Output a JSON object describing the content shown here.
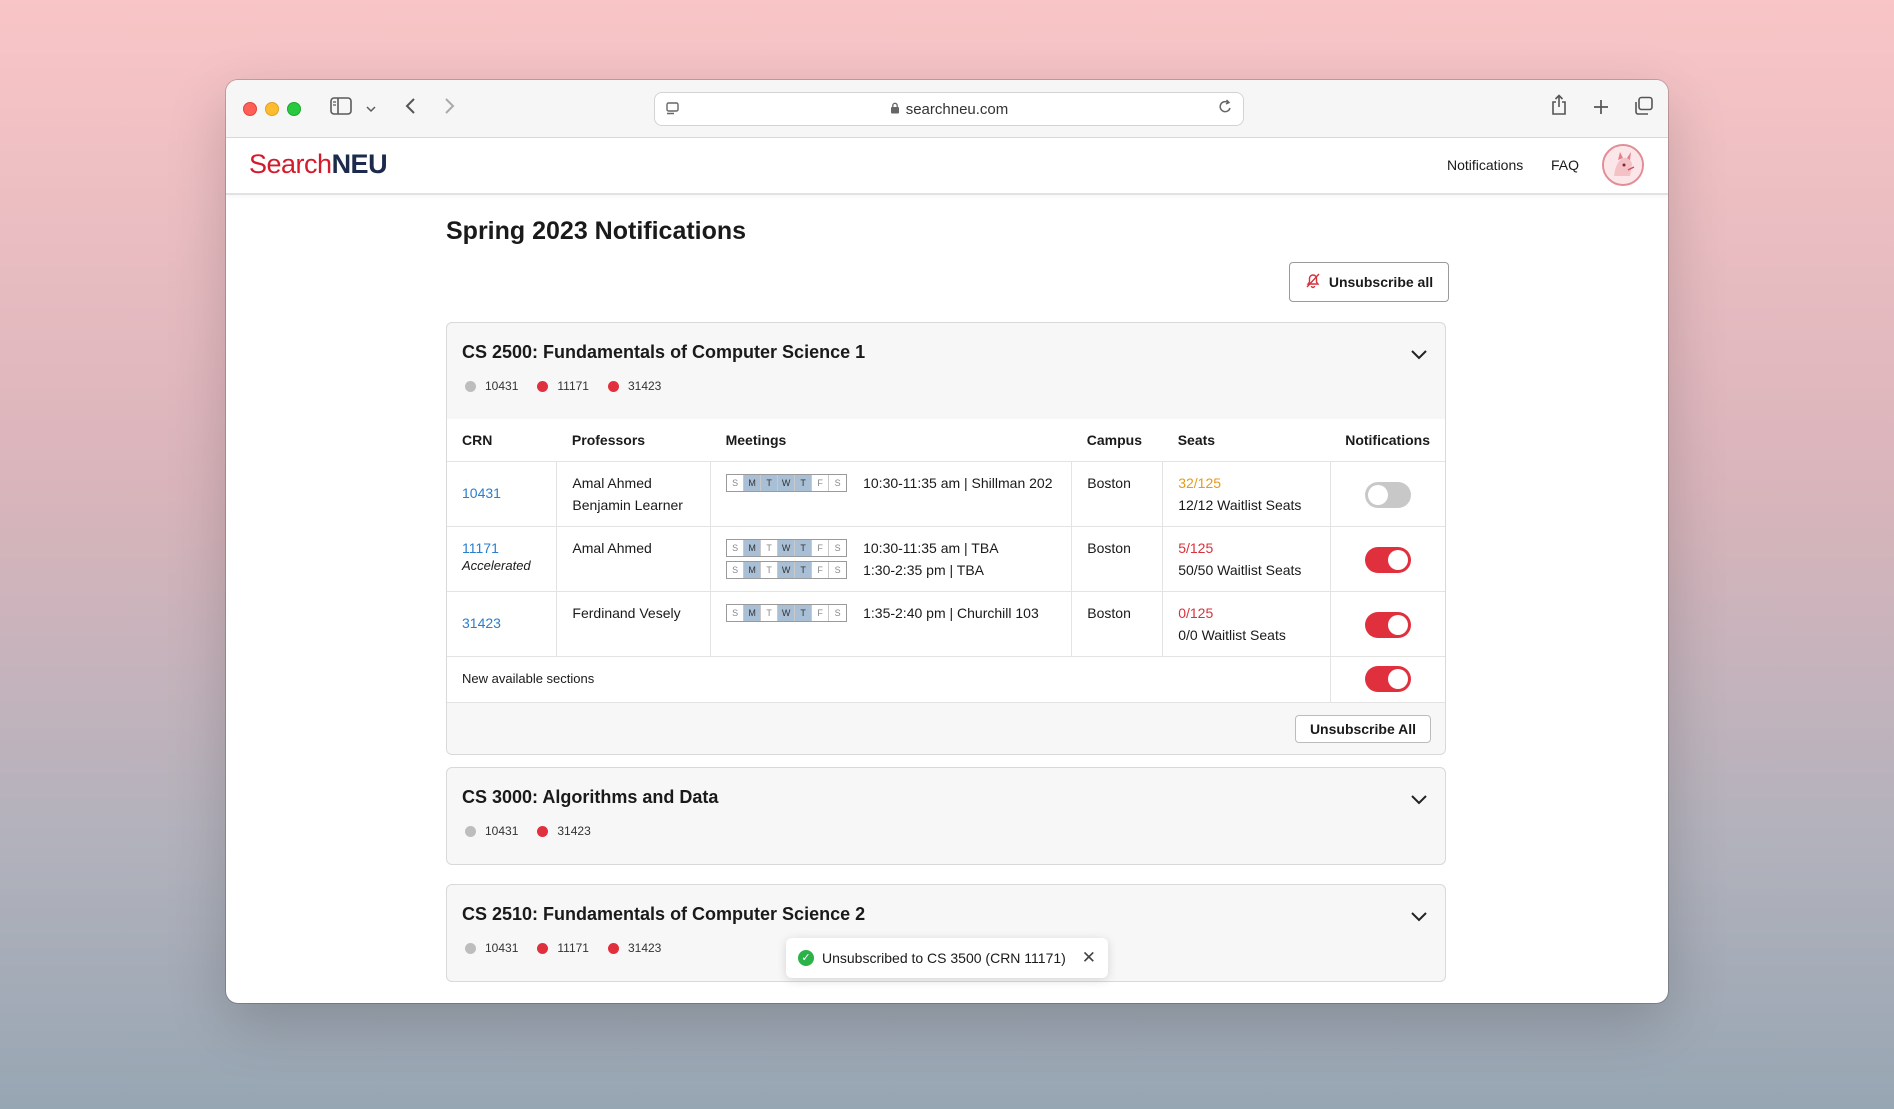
{
  "browser": {
    "url": "searchneu.com",
    "icons": [
      "sidebar-icon",
      "chevron-down-icon",
      "back-icon",
      "forward-icon",
      "reader-icon",
      "lock-icon",
      "reload-icon",
      "share-icon",
      "new-tab-icon",
      "tabs-overview-icon"
    ]
  },
  "site": {
    "logo_part1": "Search",
    "logo_part2": "NEU",
    "nav_notifications": "Notifications",
    "nav_faq": "FAQ"
  },
  "page": {
    "title": "Spring 2023 Notifications",
    "unsubscribe_all": "Unsubscribe all"
  },
  "courses": [
    {
      "title": "CS 2500: Fundamentals of Computer Science 1",
      "expanded": true,
      "pills": [
        {
          "crn": "10431",
          "status": "gray"
        },
        {
          "crn": "11171",
          "status": "red"
        },
        {
          "crn": "31423",
          "status": "red"
        }
      ],
      "columns": [
        "CRN",
        "Professors",
        "Meetings",
        "Campus",
        "Seats",
        "Notifications"
      ],
      "sections": [
        {
          "crn": "10431",
          "tag": "",
          "professors": [
            "Amal Ahmed",
            "Benjamin Learner"
          ],
          "meetings": [
            {
              "days": "SMTWTFS",
              "active": [
                1,
                2,
                3,
                4
              ],
              "text": "10:30-11:35 am | Shillman 202"
            }
          ],
          "campus": "Boston",
          "seats": "32/125",
          "seats_color": "orange",
          "waitlist": "12/12 Waitlist Seats",
          "notify": false
        },
        {
          "crn": "11171",
          "tag": "Accelerated",
          "professors": [
            "Amal Ahmed"
          ],
          "meetings": [
            {
              "days": "SMTWTFS",
              "active": [
                1,
                3,
                4
              ],
              "text": "10:30-11:35 am | TBA"
            },
            {
              "days": "SMTWTFS",
              "active": [
                1,
                3,
                4
              ],
              "text": "1:30-2:35 pm | TBA"
            }
          ],
          "campus": "Boston",
          "seats": "5/125",
          "seats_color": "red",
          "waitlist": "50/50 Waitlist Seats",
          "notify": true
        },
        {
          "crn": "31423",
          "tag": "",
          "professors": [
            "Ferdinand Vesely"
          ],
          "meetings": [
            {
              "days": "SMTWTFS",
              "active": [
                1,
                3,
                4
              ],
              "text": "1:35-2:40 pm | Churchill 103"
            }
          ],
          "campus": "Boston",
          "seats": "0/125",
          "seats_color": "red",
          "waitlist": "0/0 Waitlist Seats",
          "notify": true
        }
      ],
      "new_sections_label": "New available sections",
      "new_sections_notify": true,
      "footer_button": "Unsubscribe All"
    },
    {
      "title": "CS 3000: Algorithms and Data",
      "expanded": false,
      "pills": [
        {
          "crn": "10431",
          "status": "gray"
        },
        {
          "crn": "31423",
          "status": "red"
        }
      ]
    },
    {
      "title": "CS 2510: Fundamentals of Computer Science 2",
      "expanded": false,
      "pills": [
        {
          "crn": "10431",
          "status": "gray"
        },
        {
          "crn": "11171",
          "status": "red"
        },
        {
          "crn": "31423",
          "status": "red"
        }
      ]
    }
  ],
  "toast": {
    "message": "Unsubscribed to CS 3500 (CRN 11171)"
  },
  "colors": {
    "brand_red": "#d41b2c",
    "brand_navy": "#1c2b4b",
    "link_blue": "#2a7ed0",
    "seats_orange": "#e89a18",
    "seats_red": "#d8323c",
    "toggle_on": "#e1303d",
    "toggle_off": "#c8c8c8",
    "day_active": "#a9bfd6",
    "success_green": "#2bb34a"
  }
}
